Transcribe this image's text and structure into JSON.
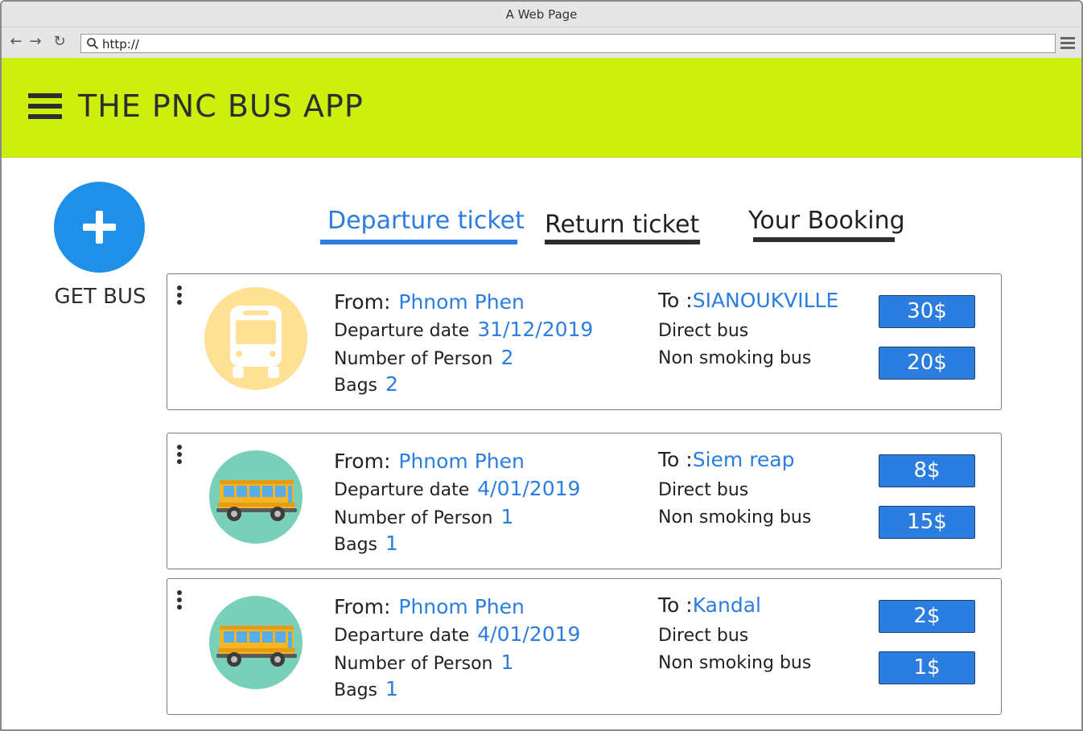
{
  "browser": {
    "window_title": "A Web Page",
    "url": "http://"
  },
  "app": {
    "title": "THE PNC BUS APP",
    "accent_color": "#cdef0e",
    "primary_color": "#2b7de0"
  },
  "fab": {
    "label": "GET BUS",
    "icon": "plus-icon"
  },
  "tabs": [
    {
      "label": "Departure ticket",
      "active": true
    },
    {
      "label": "Return ticket",
      "active": false
    },
    {
      "label": "Your Booking",
      "active": false
    }
  ],
  "labels": {
    "from": "From:",
    "to": "To :",
    "departure_date": "Departure date",
    "persons": "Number of Person",
    "bags": "Bags"
  },
  "tickets": [
    {
      "icon": "bus-front-icon",
      "from": "Phnom Phen",
      "to": "SIANOUKVILLE",
      "date": "31/12/2019",
      "persons": "2",
      "bags": "2",
      "features": [
        "Direct bus",
        "Non smoking bus"
      ],
      "prices": [
        "30$",
        "20$"
      ]
    },
    {
      "icon": "school-bus-icon",
      "from": "Phnom Phen",
      "to": "Siem reap",
      "date": "4/01/2019",
      "persons": "1",
      "bags": "1",
      "features": [
        "Direct bus",
        "Non smoking bus"
      ],
      "prices": [
        "8$",
        "15$"
      ]
    },
    {
      "icon": "school-bus-icon",
      "from": "Phnom Phen",
      "to": "Kandal",
      "date": "4/01/2019",
      "persons": "1",
      "bags": "1",
      "features": [
        "Direct bus",
        "Non smoking bus"
      ],
      "prices": [
        "2$",
        "1$"
      ]
    }
  ]
}
